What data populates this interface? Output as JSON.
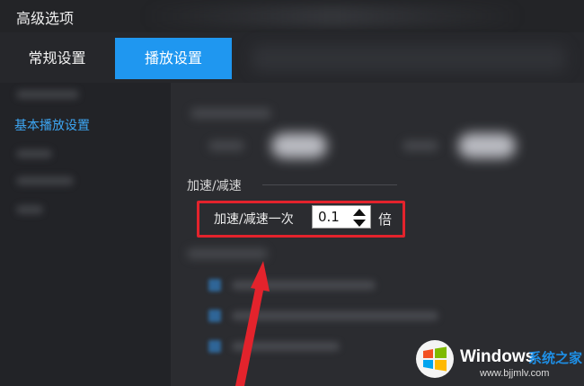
{
  "window": {
    "title": "高级选项"
  },
  "tabs": [
    {
      "label": "常规设置",
      "active": false
    },
    {
      "label": "播放设置",
      "active": true
    }
  ],
  "sidebar": {
    "active_item": "基本播放设置"
  },
  "section": {
    "title": "加速/减速"
  },
  "speed_step": {
    "label": "加速/减速一次",
    "value": "0.1",
    "unit": "倍"
  },
  "colors": {
    "accent": "#1f97f0",
    "highlight": "#e3232c",
    "link": "#3da7f5"
  },
  "watermark": {
    "brand": "Windows",
    "site_name": "系统之家",
    "url": "www.bjjmlv.com"
  }
}
